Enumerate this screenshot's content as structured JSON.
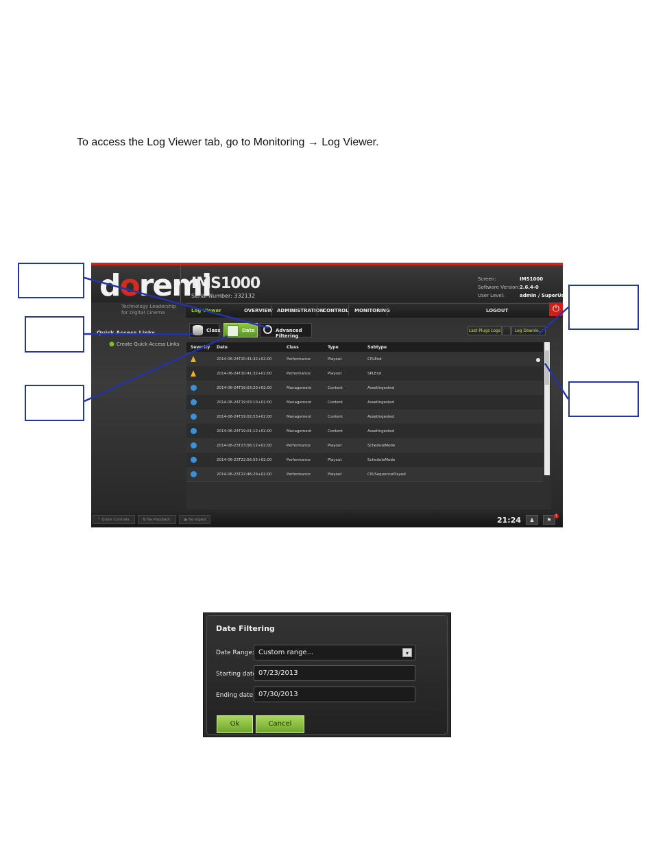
{
  "intro_text": "To access the Log Viewer tab, go to Monitoring → Log Viewer.",
  "app": {
    "logo": "doremi",
    "tagline": "Technology Leadership for Digital Cinema",
    "product": "IMS1000",
    "serial": "Serial Number: 332132",
    "info": [
      {
        "label": "Screen:",
        "value": "IMS1000"
      },
      {
        "label": "Software Version:",
        "value": "2.6.4-0"
      },
      {
        "label": "User Level:",
        "value": "admin / SuperUser"
      }
    ],
    "nav": {
      "active_tab": "Log Viewer",
      "items": [
        "OVERVIEW",
        "ADMINISTRATION",
        "CONTROL",
        "MONITORING"
      ],
      "logout": "LOGOUT"
    },
    "sidebar": {
      "title": "Quick Access Links",
      "link": "Create Quick Access Links"
    },
    "toolbar": {
      "class_label": "Class",
      "date_label": "Date",
      "advanced_label": "Advanced Filtering",
      "last_logs_label": "Last Plugs Logs",
      "download_label": "Log Downlo..."
    },
    "table": {
      "headers": [
        "Severity",
        "Date",
        "Class",
        "Type",
        "Subtype"
      ],
      "rows": [
        {
          "severity": "warning",
          "date": "2014-06-24T20:41:32+02:00",
          "class": "Performance",
          "type": "Playout",
          "subtype": "CPLEnd"
        },
        {
          "severity": "warning",
          "date": "2014-06-24T20:41:32+02:00",
          "class": "Performance",
          "type": "Playout",
          "subtype": "SPLEnd"
        },
        {
          "severity": "info",
          "date": "2014-06-24T19:03:20+02:00",
          "class": "Management",
          "type": "Content",
          "subtype": "AssetIngested"
        },
        {
          "severity": "info",
          "date": "2014-06-24T19:03:10+02:00",
          "class": "Management",
          "type": "Content",
          "subtype": "AssetIngested"
        },
        {
          "severity": "info",
          "date": "2014-06-24T19:02:53+02:00",
          "class": "Management",
          "type": "Content",
          "subtype": "AssetIngested"
        },
        {
          "severity": "info",
          "date": "2014-06-24T19:01:12+02:00",
          "class": "Management",
          "type": "Content",
          "subtype": "AssetIngested"
        },
        {
          "severity": "info",
          "date": "2014-06-23T23:06:12+02:00",
          "class": "Performance",
          "type": "Playout",
          "subtype": "ScheduleMode"
        },
        {
          "severity": "info",
          "date": "2014-06-23T22:56:55+02:00",
          "class": "Performance",
          "type": "Playout",
          "subtype": "ScheduleMode"
        },
        {
          "severity": "info",
          "date": "2014-06-23T22:46:29+02:00",
          "class": "Performance",
          "type": "Playout",
          "subtype": "CPLSequencePlayed"
        }
      ]
    },
    "footer": {
      "quick_controls": "Quick Controls",
      "no_playback": "No Playback",
      "no_ingest": "No Ingest",
      "clock": "21:24",
      "alert_count": "1"
    },
    "colors": {
      "accent_green": "#8cc63c",
      "brand_red": "#c8281e",
      "callout_blue": "#2433a8"
    }
  },
  "dialog": {
    "title": "Date Filtering",
    "date_range_label": "Date Range:",
    "date_range_value": "Custom range...",
    "starting_label": "Starting date:",
    "starting_value": "07/23/2013",
    "ending_label": "Ending date:",
    "ending_value": "07/30/2013",
    "ok_label": "Ok",
    "cancel_label": "Cancel"
  }
}
